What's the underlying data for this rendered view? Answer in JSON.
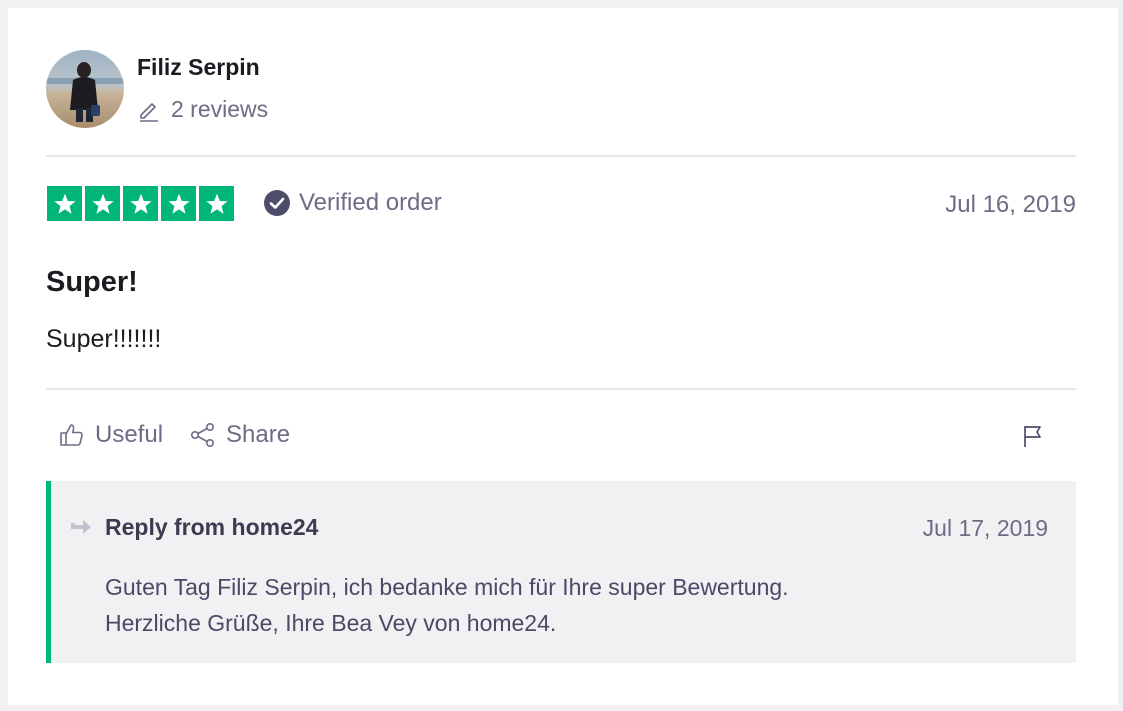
{
  "consumer": {
    "name": "Filiz Serpin",
    "reviews_label": "2 reviews"
  },
  "rating": {
    "stars": 5,
    "max_stars": 5,
    "color": "#00b67a"
  },
  "verified_label": "Verified order",
  "review": {
    "date": "Jul 16, 2019",
    "title": "Super!",
    "body": "Super!!!!!!!"
  },
  "actions": {
    "useful_label": "Useful",
    "share_label": "Share"
  },
  "reply": {
    "header": "Reply from home24",
    "date": "Jul 17, 2019",
    "line1": "Guten Tag Filiz Serpin, ich bedanke mich für Ihre super Bewertung.",
    "line2": "Herzliche Grüße, Ihre Bea Vey von home24.",
    "accent_color": "#00b67a"
  },
  "icons": {
    "avatar": "avatar-photo",
    "reviews": "pencil-icon",
    "verified": "check-circle-icon",
    "star": "star-icon",
    "useful": "thumbs-up-icon",
    "share": "share-icon",
    "flag": "flag-icon",
    "reply": "reply-arrow-icon"
  }
}
